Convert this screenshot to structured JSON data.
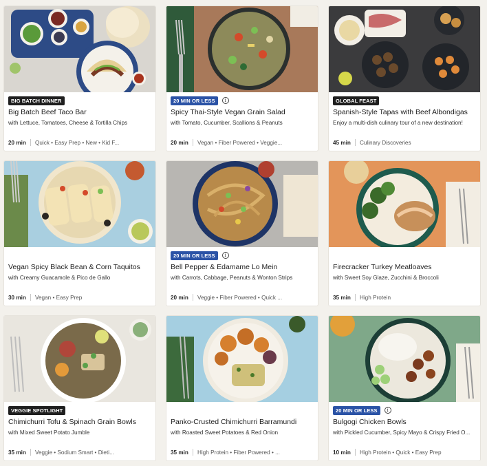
{
  "recipes": [
    {
      "tag": "BIG BATCH DINNER",
      "tag_style": "dark",
      "tag_info": false,
      "title": "Big Batch Beef Taco Bar",
      "subtitle": "with Lettuce, Tomatoes, Cheese & Tortilla Chips",
      "time": "20 min",
      "tags": "Quick • Easy Prep • New • Kid F...",
      "image": "taco-bar-photo"
    },
    {
      "tag": "20 MIN OR LESS",
      "tag_style": "blue",
      "tag_info": true,
      "title": "Spicy Thai-Style Vegan Grain Salad",
      "subtitle": "with Tomato, Cucumber, Scallions & Peanuts",
      "time": "20 min",
      "tags": "Vegan • Fiber Powered • Veggie...",
      "image": "grain-salad-photo"
    },
    {
      "tag": "GLOBAL FEAST",
      "tag_style": "dark",
      "tag_info": false,
      "title": "Spanish-Style Tapas with Beef Albondigas",
      "subtitle": "Enjoy a multi-dish culinary tour of a new destination!",
      "time": "45 min",
      "tags": "Culinary Discoveries",
      "image": "tapas-photo"
    },
    {
      "tag": "",
      "tag_style": "none",
      "tag_info": false,
      "title": "Vegan Spicy Black Bean & Corn Taquitos",
      "subtitle": "with Creamy Guacamole & Pico de Gallo",
      "time": "30 min",
      "tags": "Vegan • Easy Prep",
      "image": "taquitos-photo"
    },
    {
      "tag": "20 MIN OR LESS",
      "tag_style": "blue",
      "tag_info": true,
      "title": "Bell Pepper & Edamame Lo Mein",
      "subtitle": "with Carrots, Cabbage, Peanuts & Wonton Strips",
      "time": "20 min",
      "tags": "Veggie • Fiber Powered • Quick ...",
      "image": "lo-mein-photo"
    },
    {
      "tag": "",
      "tag_style": "none",
      "tag_info": false,
      "title": "Firecracker Turkey Meatloaves",
      "subtitle": "with Sweet Soy Glaze, Zucchini & Broccoli",
      "time": "35 min",
      "tags": "High Protein",
      "image": "meatloaves-photo"
    },
    {
      "tag": "VEGGIE SPOTLIGHT",
      "tag_style": "dark",
      "tag_info": false,
      "title": "Chimichurri Tofu & Spinach Grain Bowls",
      "subtitle": "with Mixed Sweet Potato Jumble",
      "time": "35 min",
      "tags": "Veggie • Sodium Smart • Dieti...",
      "image": "tofu-bowl-photo"
    },
    {
      "tag": "",
      "tag_style": "none",
      "tag_info": false,
      "title": "Panko-Crusted Chimichurri Barramundi",
      "subtitle": "with Roasted Sweet Potatoes & Red Onion",
      "time": "35 min",
      "tags": "High Protein • Fiber Powered • ...",
      "image": "barramundi-photo"
    },
    {
      "tag": "20 MIN OR LESS",
      "tag_style": "blue",
      "tag_info": true,
      "title": "Bulgogi Chicken Bowls",
      "subtitle": "with Pickled Cucumber, Spicy Mayo & Crispy Fried O...",
      "time": "10 min",
      "tags": "High Protein • Quick • Easy Prep",
      "image": "bulgogi-photo"
    }
  ],
  "colors": {
    "blue_tag": "#2b53a6",
    "dark_tag": "#1f1f1f"
  }
}
